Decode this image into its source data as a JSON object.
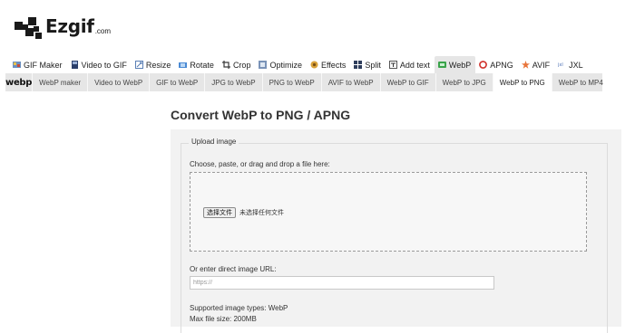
{
  "header": {
    "logo_text": "Ezgif",
    "logo_tld": ".com"
  },
  "nav": [
    {
      "label": "GIF Maker",
      "icon": "gif-maker-icon",
      "active": false
    },
    {
      "label": "Video to GIF",
      "icon": "video-icon",
      "active": false
    },
    {
      "label": "Resize",
      "icon": "resize-icon",
      "active": false
    },
    {
      "label": "Rotate",
      "icon": "rotate-icon",
      "active": false
    },
    {
      "label": "Crop",
      "icon": "crop-icon",
      "active": false
    },
    {
      "label": "Optimize",
      "icon": "optimize-icon",
      "active": false
    },
    {
      "label": "Effects",
      "icon": "effects-icon",
      "active": false
    },
    {
      "label": "Split",
      "icon": "split-icon",
      "active": false
    },
    {
      "label": "Add text",
      "icon": "add-text-icon",
      "active": false
    },
    {
      "label": "WebP",
      "icon": "webp-icon",
      "active": true
    },
    {
      "label": "APNG",
      "icon": "apng-icon",
      "active": false
    },
    {
      "label": "AVIF",
      "icon": "avif-icon",
      "active": false
    },
    {
      "label": "JXL",
      "icon": "jxl-icon",
      "active": false
    }
  ],
  "subnav": {
    "brand": "webp",
    "tabs": [
      {
        "label": "WebP maker",
        "active": false
      },
      {
        "label": "Video to WebP",
        "active": false
      },
      {
        "label": "GIF to WebP",
        "active": false
      },
      {
        "label": "JPG to WebP",
        "active": false
      },
      {
        "label": "PNG to WebP",
        "active": false
      },
      {
        "label": "AVIF to WebP",
        "active": false
      },
      {
        "label": "WebP to GIF",
        "active": false
      },
      {
        "label": "WebP to JPG",
        "active": false
      },
      {
        "label": "WebP to PNG",
        "active": true
      },
      {
        "label": "WebP to MP4",
        "active": false
      }
    ]
  },
  "main": {
    "title": "Convert WebP to PNG / APNG",
    "upload_legend": "Upload image",
    "choose_label": "Choose, paste, or drag and drop a file here:",
    "file_button": "选择文件",
    "file_status": "未选择任何文件",
    "url_label": "Or enter direct image URL:",
    "url_value": "",
    "url_placeholder": "https://",
    "supported_types": "Supported image types: WebP",
    "max_size": "Max file size: 200MB"
  },
  "colors": {
    "subbar_bg": "#e6e6e6",
    "panel_bg": "#f2f2f2",
    "apng_red": "#d0302a",
    "webp_green": "#3aa34a"
  }
}
